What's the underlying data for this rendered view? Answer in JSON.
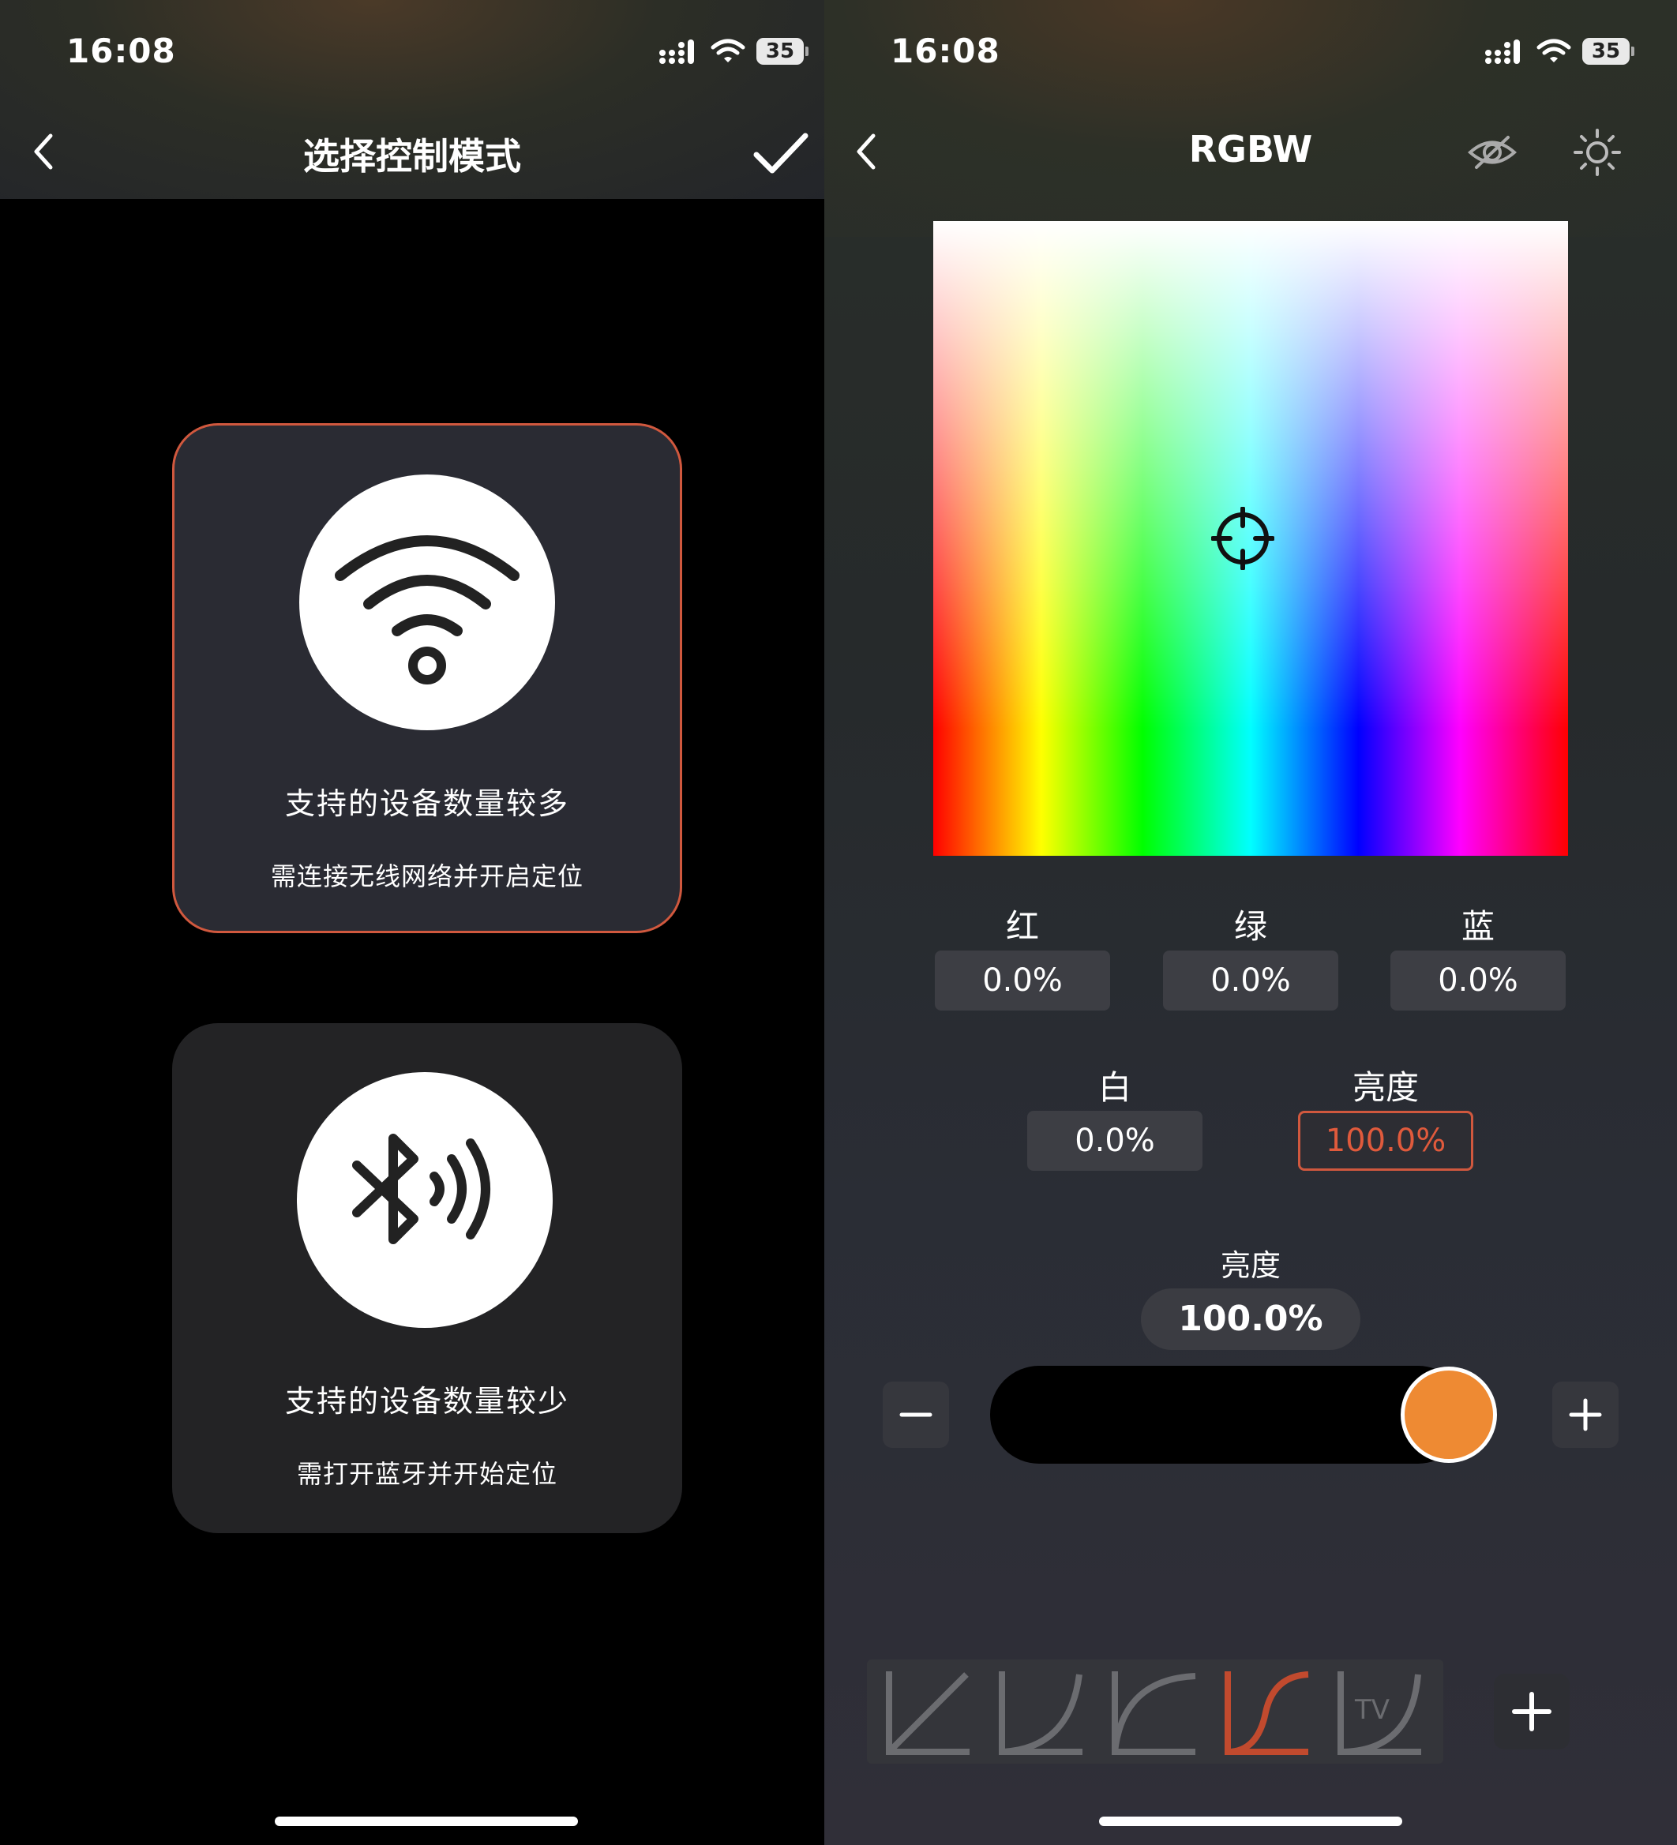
{
  "status_bar": {
    "time": "16:08",
    "battery": "35"
  },
  "left_screen": {
    "title": "选择控制模式",
    "wifi_mode": {
      "main_text": "支持的设备数量较多",
      "sub_text": "需连接无线网络并开启定位"
    },
    "bluetooth_mode": {
      "main_text": "支持的设备数量较少",
      "sub_text": "需打开蓝牙并开始定位"
    }
  },
  "right_screen": {
    "title": "RGBW",
    "channels": [
      {
        "label": "红",
        "value": "0.0%"
      },
      {
        "label": "绿",
        "value": "0.0%"
      },
      {
        "label": "蓝",
        "value": "0.0%"
      }
    ],
    "white": {
      "label": "白",
      "value": "0.0%"
    },
    "brightness": {
      "label": "亮度",
      "value": "100.0%"
    },
    "brightness_slider": {
      "label": "亮度",
      "value": "100.0%",
      "level": 1.0
    },
    "curves": [
      {
        "name": "linear-curve-icon"
      },
      {
        "name": "exponential-curve-icon"
      },
      {
        "name": "logarithmic-curve-icon"
      },
      {
        "name": "s-curve-icon",
        "selected": true
      },
      {
        "name": "tv-curve-icon",
        "text": "TV"
      }
    ]
  },
  "colors": {
    "accent": "#d0583e",
    "thumb": "#ee8a33"
  }
}
